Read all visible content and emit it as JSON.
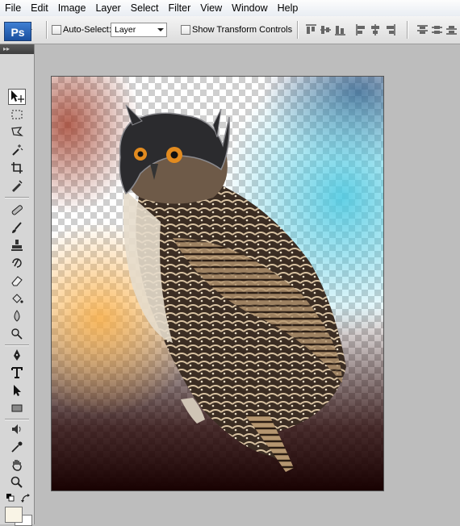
{
  "menu": {
    "items": [
      {
        "label": "File"
      },
      {
        "label": "Edit"
      },
      {
        "label": "Image"
      },
      {
        "label": "Layer"
      },
      {
        "label": "Select"
      },
      {
        "label": "Filter"
      },
      {
        "label": "View"
      },
      {
        "label": "Window"
      },
      {
        "label": "Help"
      }
    ]
  },
  "options": {
    "auto_select_label": "Auto-Select:",
    "auto_select_checked": false,
    "auto_select_target": "Layer",
    "show_transform_label": "Show Transform Controls",
    "show_transform_checked": false
  },
  "tools_panel": {
    "logo": "Ps",
    "active_tool": "move-tool"
  },
  "document": {
    "content": "owl wearing armored helmet on transparent gradient background"
  },
  "colors": {
    "foreground": "#f9f4e6",
    "background": "#ffffff"
  }
}
